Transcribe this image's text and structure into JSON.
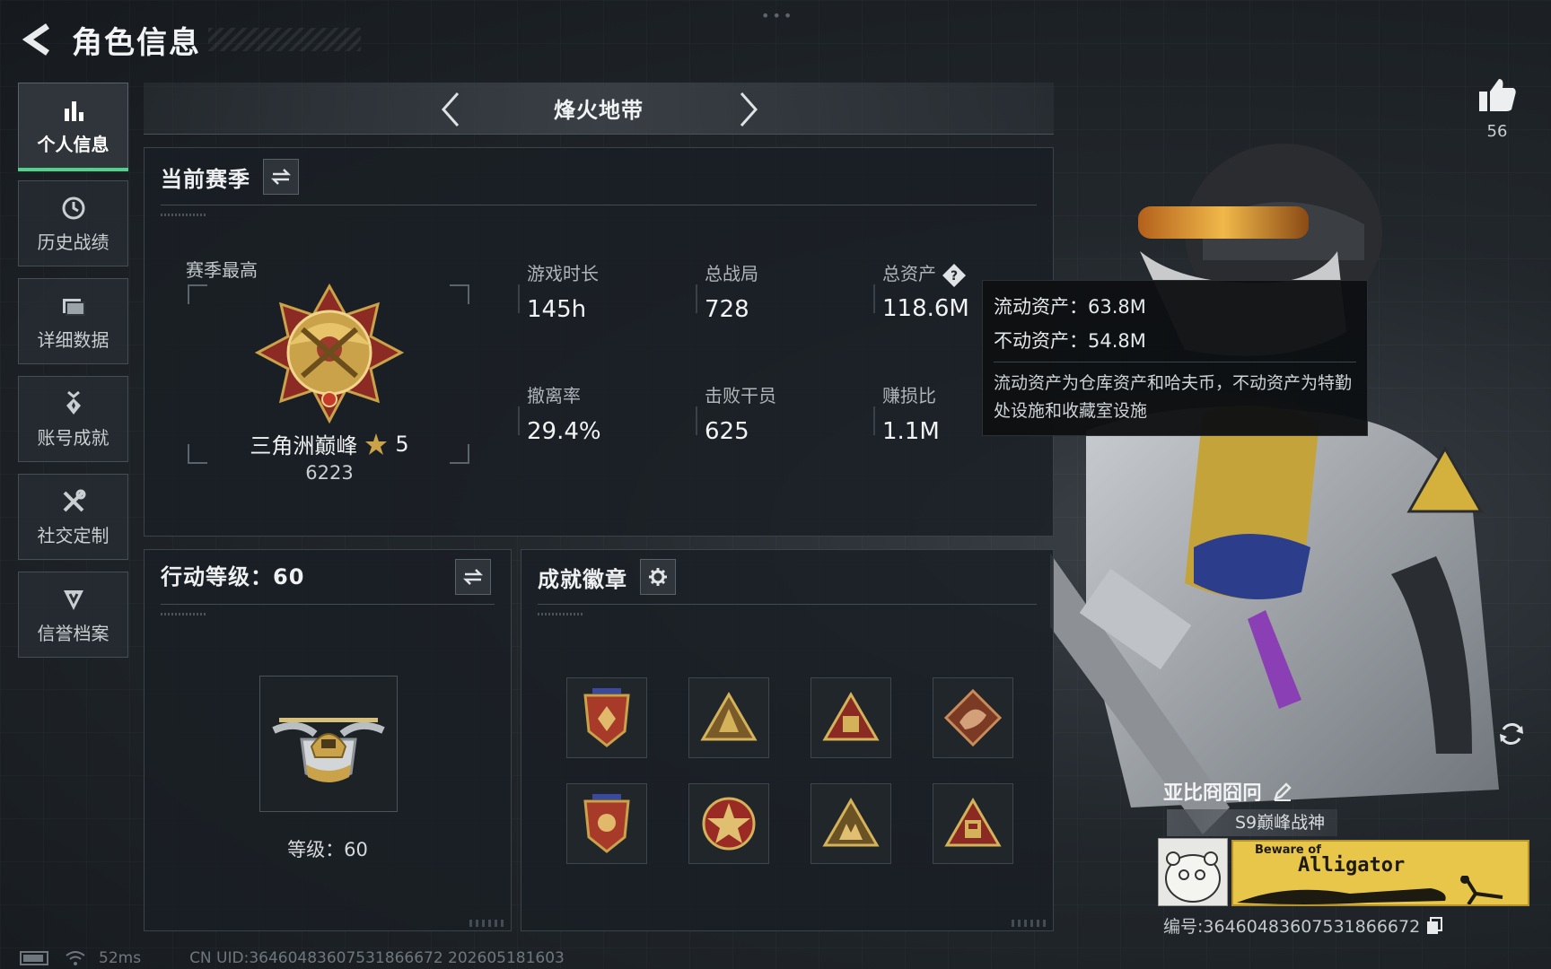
{
  "header": {
    "title": "角色信息"
  },
  "sidebar": {
    "items": [
      {
        "label": "个人信息",
        "icon": "bar-chart-icon",
        "active": true
      },
      {
        "label": "历史战绩",
        "icon": "history-icon",
        "active": false
      },
      {
        "label": "详细数据",
        "icon": "folder-icon",
        "active": false
      },
      {
        "label": "账号成就",
        "icon": "medal-icon",
        "active": false
      },
      {
        "label": "社交定制",
        "icon": "tools-icon",
        "active": false
      },
      {
        "label": "信誉档案",
        "icon": "shield-icon",
        "active": false
      }
    ]
  },
  "mode": {
    "title": "烽火地带"
  },
  "season": {
    "title": "当前赛季",
    "best_label": "赛季最高",
    "rank_name": "三角洲巅峰",
    "rank_stars": "5",
    "rank_score": "6223",
    "stats": [
      {
        "label": "游戏时长",
        "value": "145h"
      },
      {
        "label": "总战局",
        "value": "728"
      },
      {
        "label": "总资产",
        "value": "118.6M"
      },
      {
        "label": "撤离率",
        "value": "29.4%"
      },
      {
        "label": "击败干员",
        "value": "625"
      },
      {
        "label": "赚损比",
        "value": "1.1M"
      }
    ]
  },
  "tooltip": {
    "liquid": "流动资产：63.8M",
    "fixed": "不动资产：54.8M",
    "desc": "流动资产为仓库资产和哈夫币，不动资产为特勤处设施和收藏室设施"
  },
  "level": {
    "title": "行动等级：60",
    "label": "等级：60"
  },
  "badges": {
    "title": "成就徽章",
    "count": 8
  },
  "profile": {
    "likes": "56",
    "name": "亚比冏囧冋",
    "title_tag": "S9巅峰战神",
    "banner_small": "Beware of",
    "banner_main": "Alligator",
    "uid": "编号:3646048360753186667​2"
  },
  "status": {
    "ping": "52ms",
    "uid_line": "CN UID:3646048360753186667​2 202605181603"
  },
  "colors": {
    "accent": "#4fd38a",
    "gold": "#c9a24a"
  }
}
